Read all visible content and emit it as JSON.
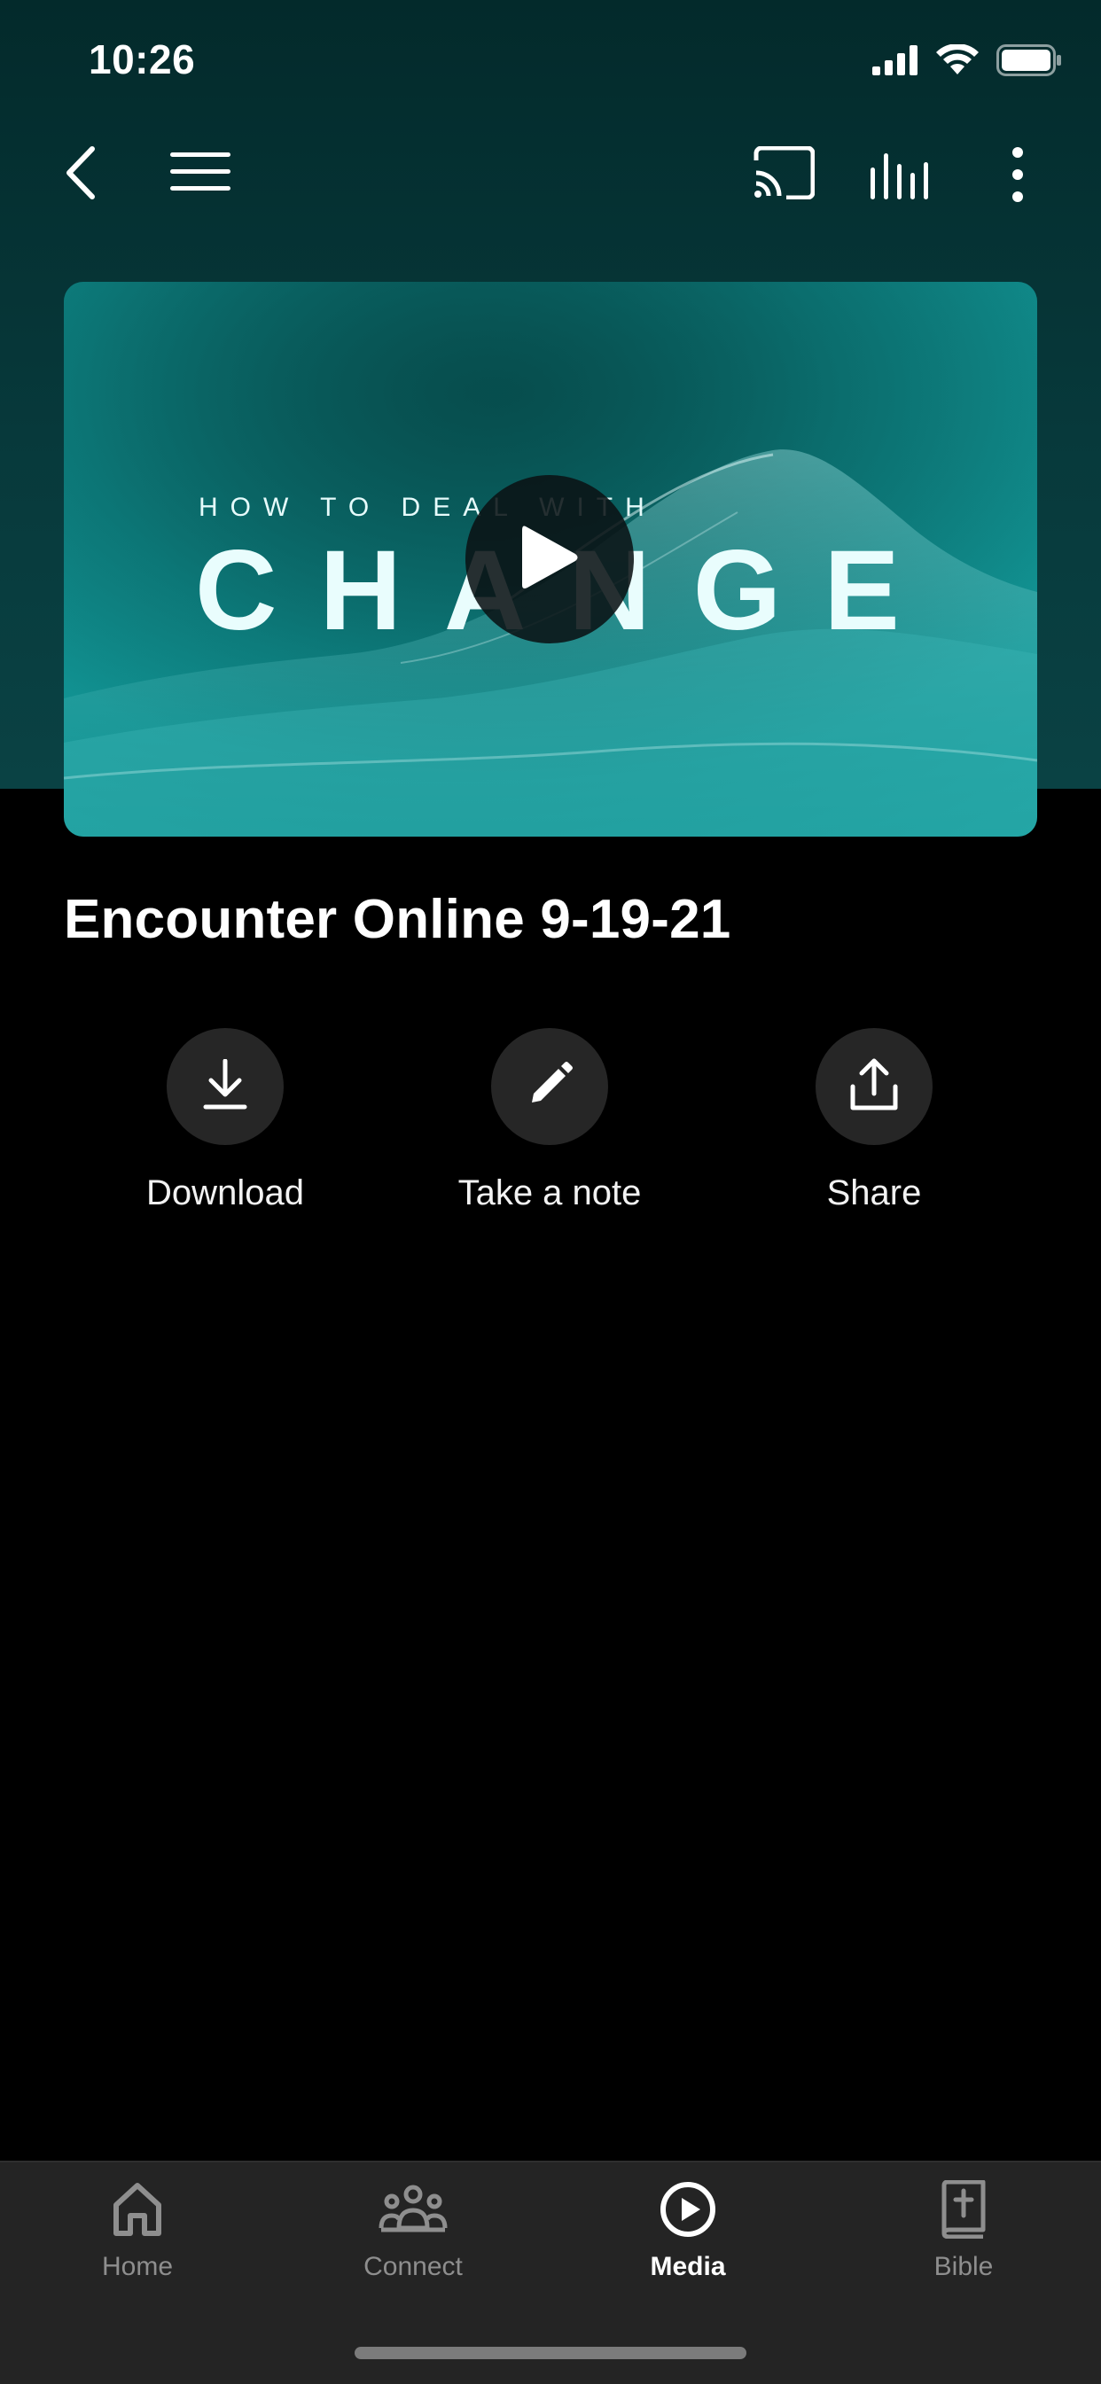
{
  "status_bar": {
    "time": "10:26"
  },
  "nav": {
    "back_icon": "chevron-left-icon",
    "menu_icon": "hamburger-menu-icon",
    "cast_icon": "cast-icon",
    "audio_icon": "audio-bars-icon",
    "more_icon": "more-vertical-icon"
  },
  "video": {
    "kicker": "HOW TO DEAL WITH",
    "headline": "CHANGE",
    "play_icon": "play-icon"
  },
  "media": {
    "title": "Encounter Online 9-19-21"
  },
  "actions": [
    {
      "label": "Download",
      "icon": "download-icon"
    },
    {
      "label": "Take a note",
      "icon": "pencil-icon"
    },
    {
      "label": "Share",
      "icon": "share-icon"
    }
  ],
  "tabs": [
    {
      "label": "Home",
      "icon": "home-icon",
      "active": false
    },
    {
      "label": "Connect",
      "icon": "people-icon",
      "active": false
    },
    {
      "label": "Media",
      "icon": "play-circle-icon",
      "active": true
    },
    {
      "label": "Bible",
      "icon": "bible-icon",
      "active": false
    }
  ],
  "colors": {
    "header_bg": "#07393b",
    "video_teal": "#0f8a8a",
    "tab_bar_bg": "#242424",
    "inactive_tab": "#8e8e8e",
    "active_tab": "#ffffff"
  }
}
